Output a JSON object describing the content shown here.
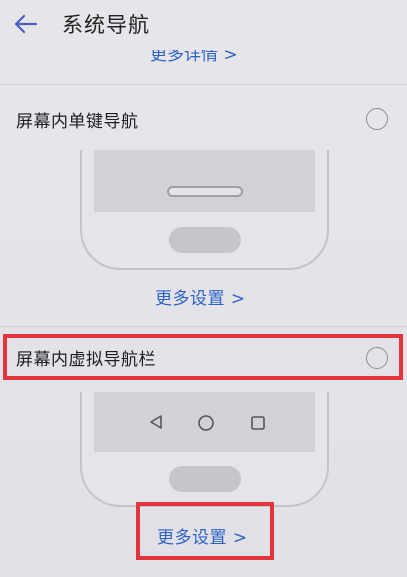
{
  "header": {
    "title": "系统导航",
    "back_icon": "arrow-left-icon"
  },
  "top_link": {
    "label": "更多详情 >"
  },
  "options": [
    {
      "label": "屏幕内单键导航",
      "selected": false,
      "more_label": "更多设置 >"
    },
    {
      "label": "屏幕内虚拟导航栏",
      "selected": false,
      "more_label": "更多设置 >",
      "nav_keys": [
        "back-triangle-icon",
        "home-circle-icon",
        "recent-square-icon"
      ]
    }
  ],
  "colors": {
    "accent_link": "#2d63c8",
    "highlight": "#e3343b",
    "background": "#e4e3e8"
  }
}
